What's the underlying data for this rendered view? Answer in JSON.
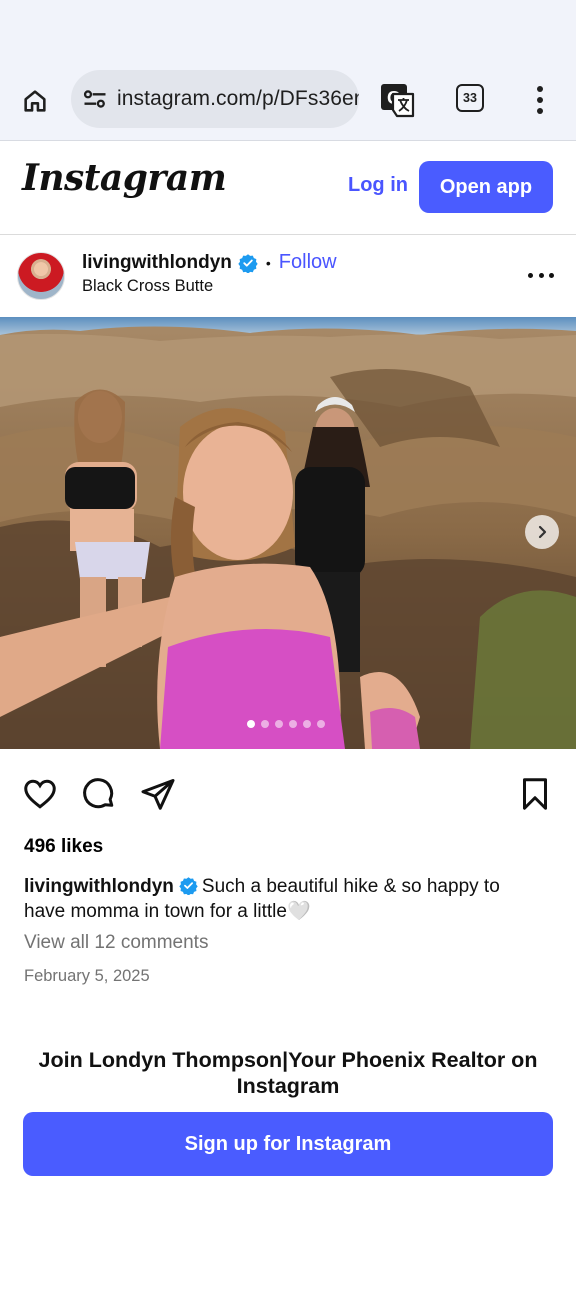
{
  "browser": {
    "url": "instagram.com/p/DFs36er",
    "tab_count": "33"
  },
  "header": {
    "logo": "Instagram",
    "login_label": "Log in",
    "open_app_label": "Open app"
  },
  "post": {
    "username": "livingwithlondyn",
    "separator": "•",
    "follow_label": "Follow",
    "location": "Black Cross Butte",
    "carousel": {
      "total_slides": 6,
      "current_slide": 1
    },
    "likes": "496 likes",
    "caption_user": "livingwithlondyn",
    "caption_text": "Such a beautiful hike & so happy to have momma in town for a little🤍",
    "view_comments": "View all 12 comments",
    "date": "February 5, 2025"
  },
  "signup": {
    "title": "Join Londyn Thompson|Your Phoenix Realtor on Instagram",
    "button_label": "Sign up for Instagram"
  },
  "colors": {
    "accent": "#4a5cff",
    "link": "#4a55ff",
    "verified": "#1d9bf0",
    "muted_text": "#737373"
  }
}
